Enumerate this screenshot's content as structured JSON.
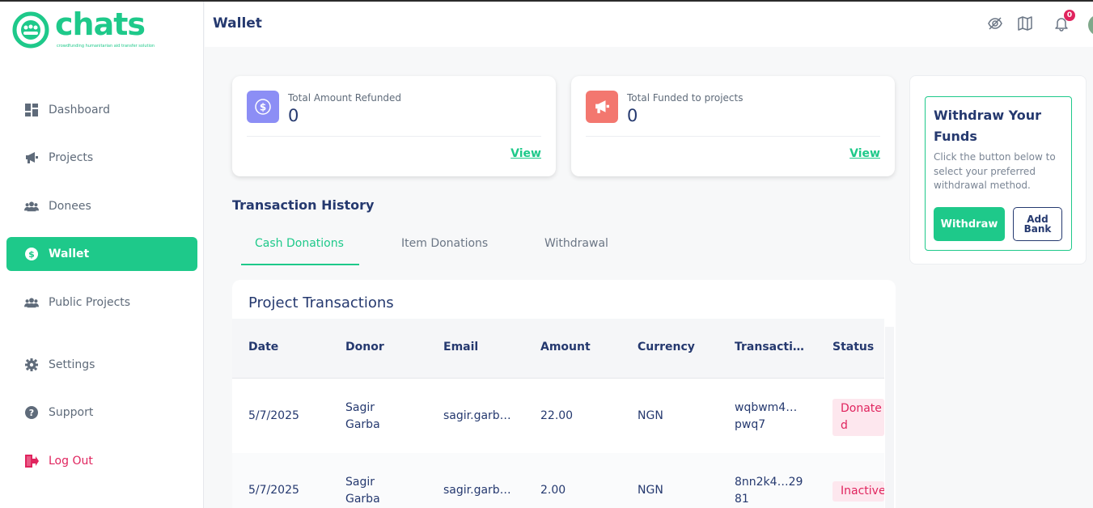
{
  "brand": {
    "name": "chats",
    "tagline": "crowdfunding humanitarian aid transfer solution",
    "accent": "#1ec98a"
  },
  "sidebar": {
    "items": [
      {
        "label": "Dashboard",
        "icon": "dashboard-icon"
      },
      {
        "label": "Projects",
        "icon": "megaphone-icon"
      },
      {
        "label": "Donees",
        "icon": "users-icon"
      },
      {
        "label": "Wallet",
        "icon": "dollar-coin-icon",
        "active": true
      },
      {
        "label": "Public Projects",
        "icon": "users-icon"
      },
      {
        "label": "Settings",
        "icon": "gear-icon"
      },
      {
        "label": "Support",
        "icon": "help-icon"
      },
      {
        "label": "Log Out",
        "icon": "logout-icon"
      }
    ]
  },
  "header": {
    "title": "Wallet",
    "notification_count": "0"
  },
  "stats": [
    {
      "label": "Total Amount Refunded",
      "value": "0",
      "link": "View",
      "icon": "dollar-coin-icon",
      "color": "#8c8ef5"
    },
    {
      "label": "Total Funded to projects",
      "value": "0",
      "link": "View",
      "icon": "megaphone-icon",
      "color": "#f3776f"
    }
  ],
  "withdraw": {
    "title": "Withdraw Your Funds",
    "description": "Click the button below to select your preferred withdrawal method.",
    "withdraw_label": "Withdraw",
    "add_bank_line1": "Add",
    "add_bank_line2": "Bank"
  },
  "history": {
    "title": "Transaction History",
    "tabs": [
      "Cash Donations",
      "Item Donations",
      "Withdrawal"
    ],
    "active_tab": 0
  },
  "table": {
    "title": "Project Transactions",
    "columns": [
      "Date",
      "Donor",
      "Email",
      "Amount",
      "Currency",
      "Transacti…",
      "Status"
    ],
    "rows": [
      {
        "date": "5/7/2025",
        "donor1": "Sagir",
        "donor2": "Garba",
        "email": "sagir.garb…",
        "amount": "22.00",
        "currency": "NGN",
        "tx1": "wqbwm4…",
        "tx2": "pwq7",
        "status1": "Donate",
        "status2": "d"
      },
      {
        "date": "5/7/2025",
        "donor1": "Sagir",
        "donor2": "Garba",
        "email": "sagir.garb…",
        "amount": "2.00",
        "currency": "NGN",
        "tx1": "8nn2k4…29",
        "tx2": "81",
        "status1": "Inactive",
        "status2": ""
      }
    ]
  }
}
